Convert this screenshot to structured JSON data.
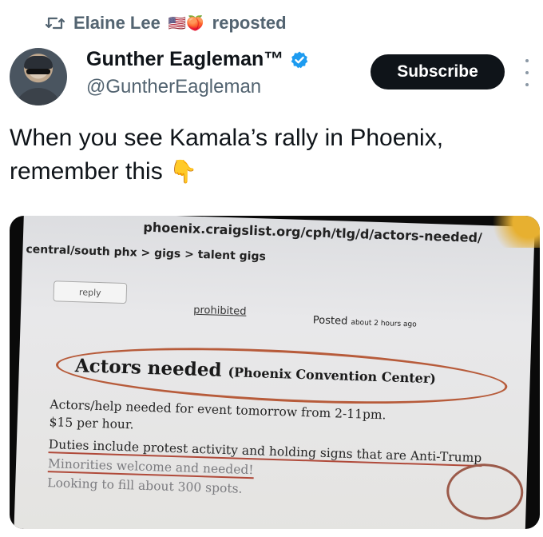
{
  "repost": {
    "user": "Elaine Lee",
    "emoji": "🇺🇸🍑",
    "label": "reposted"
  },
  "author": {
    "display_name": "Gunther Eagleman™",
    "handle": "@GuntherEagleman",
    "verified": true
  },
  "actions": {
    "subscribe_label": "Subscribe"
  },
  "tweet": {
    "line1": "When you see Kamala’s rally in Phoenix,",
    "line2": "remember this",
    "emoji": "👇"
  },
  "screenshot": {
    "url": "phoenix.craigslist.org/cph/tlg/d/actors-needed/",
    "breadcrumb": "central/south phx > gigs > talent gigs",
    "reply": "reply",
    "prohibited": "prohibited",
    "posted_label": "Posted",
    "posted_time": "about 2 hours ago",
    "title": "Actors needed",
    "title_location": "(Phoenix Convention Center)",
    "body": [
      "Actors/help needed for event tomorrow from 2-11pm.",
      "$15 per hour.",
      "Duties include protest activity and holding signs that are Anti-Trump",
      "Minorities welcome and needed!",
      "Looking to fill about 300 spots."
    ]
  },
  "colors": {
    "text": "#0f1419",
    "secondary": "#536471",
    "verified": "#1d9bf0",
    "button_bg": "#0f1419"
  }
}
